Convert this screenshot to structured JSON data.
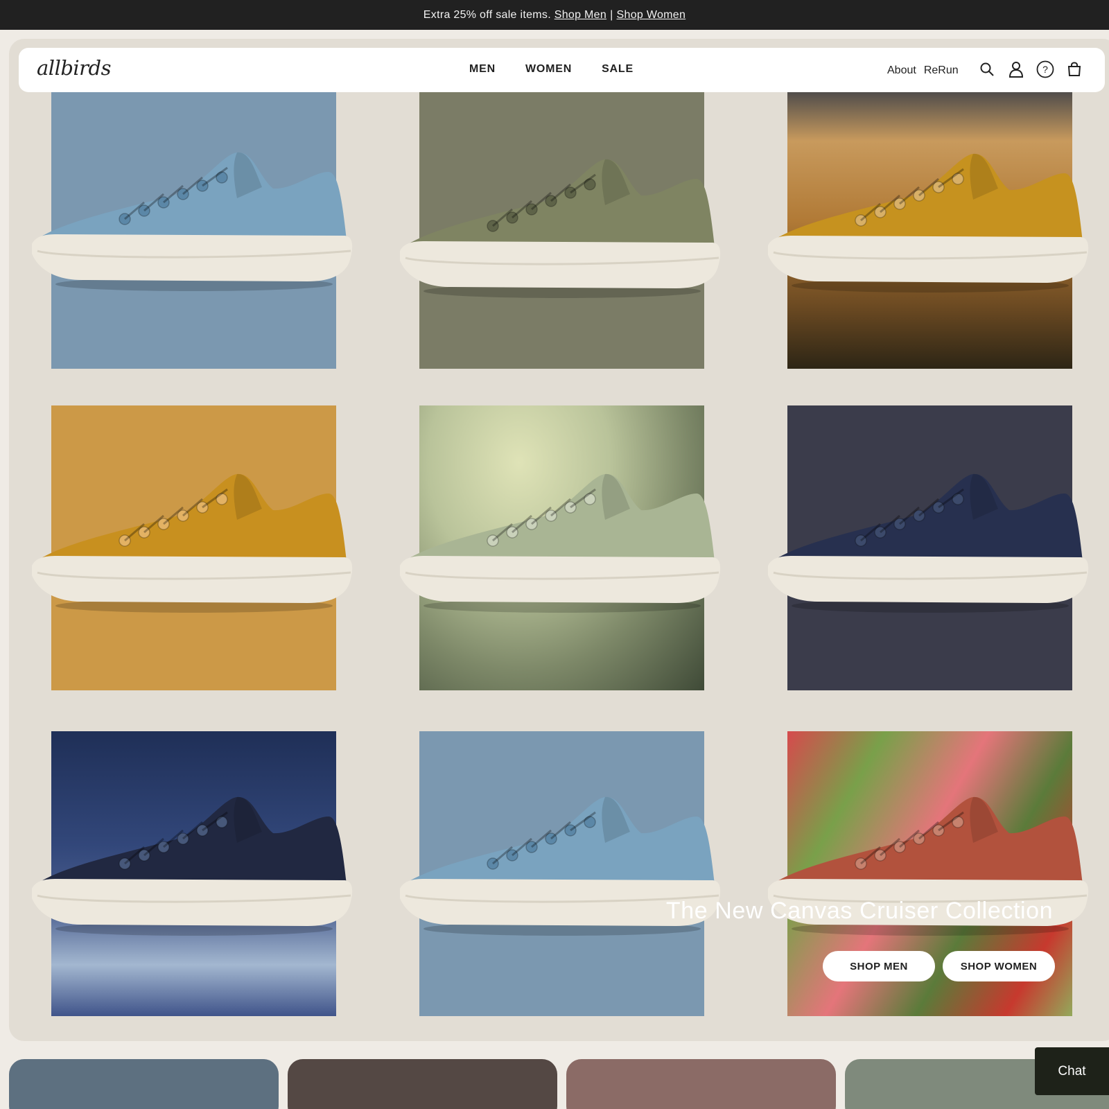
{
  "promo": {
    "text": "Extra 25% off sale items.",
    "shop_men": "Shop Men",
    "separator": "|",
    "shop_women": "Shop Women"
  },
  "nav": {
    "logo": "allbirds",
    "links": [
      "MEN",
      "WOMEN",
      "SALE"
    ],
    "secondary": [
      "About",
      "ReRun"
    ],
    "icons": [
      "search-icon",
      "account-icon",
      "help-icon",
      "cart-icon"
    ]
  },
  "hero": {
    "title": "The New Canvas Cruiser Collection",
    "cta_men": "SHOP MEN",
    "cta_women": "SHOP WOMEN"
  },
  "tiles": [
    {
      "background": "#7b98b0",
      "upper": "#7aa3bf",
      "eyelet": "#5b87a7"
    },
    {
      "background": "#7b7c66",
      "upper": "#7f8462",
      "eyelet": "#5e6348"
    },
    {
      "background": "wheat-field",
      "upper": "#c6921f",
      "eyelet": "#d8b067"
    },
    {
      "background": "#cc9947",
      "upper": "#c8901f",
      "eyelet": "#e3b264"
    },
    {
      "background": "agave",
      "upper": "#a9b594",
      "eyelet": "#cad2bb"
    },
    {
      "background": "#3b3c4b",
      "upper": "#27304f",
      "eyelet": "#3c4a6b"
    },
    {
      "background": "night-sky",
      "upper": "#212841",
      "eyelet": "#47587a"
    },
    {
      "background": "#7b98b0",
      "upper": "#7aa3bf",
      "eyelet": "#5b87a7"
    },
    {
      "background": "coral-plants",
      "upper": "#b2523d",
      "eyelet": "#c7826e"
    }
  ],
  "bottom_cards": [
    "#5d7080",
    "#544844",
    "#8b6b66",
    "#7f8a7c"
  ],
  "chat": {
    "label": "Chat"
  },
  "colors": {
    "promo_bg": "#212121",
    "hero_bg": "#e2ddd4",
    "chat_bg": "#1e2219"
  }
}
